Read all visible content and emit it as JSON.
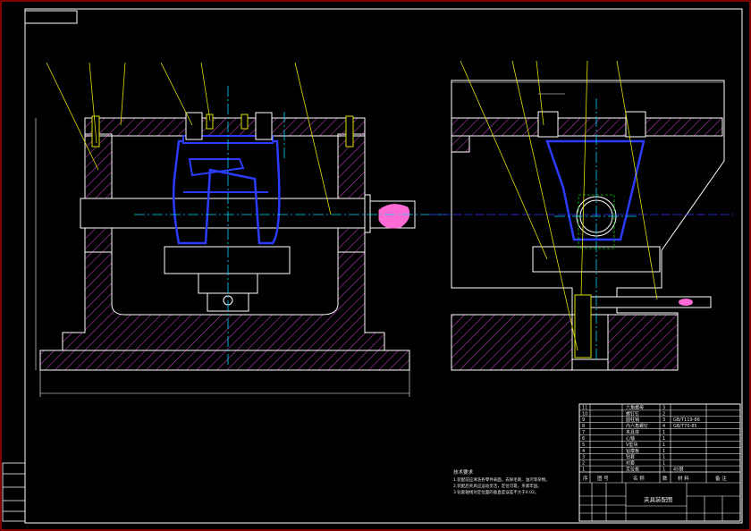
{
  "colors": {
    "background": "#000000",
    "border": "#ff0000",
    "outline": "#ffffff",
    "hatch": "#c040c0",
    "part": "#2b3cff",
    "centerline": "#00d8ff",
    "leader": "#e0e000",
    "fastener": "#e0e000",
    "workpiece": "#ff6ad5",
    "green": "#00c000"
  },
  "title_block": {
    "drawing_title": "夹具装配图",
    "columns": [
      "序",
      "图  号",
      "名  称",
      "数",
      "材  料",
      "备  注"
    ],
    "parts": [
      {
        "no": "11",
        "name": "六角螺母",
        "qty": "3",
        "material": ""
      },
      {
        "no": "10",
        "name": "螺钉钉",
        "qty": "2",
        "material": ""
      },
      {
        "no": "9",
        "name": "圆柱销",
        "qty": "3",
        "material": "GB/T119-86"
      },
      {
        "no": "8",
        "name": "内六角螺钉",
        "qty": "4",
        "material": "GB/T70-85"
      },
      {
        "no": "7",
        "name": "夹具体",
        "qty": "1",
        "material": ""
      },
      {
        "no": "6",
        "name": "心轴",
        "qty": "1",
        "material": ""
      },
      {
        "no": "5",
        "name": "V型块",
        "qty": "1",
        "material": ""
      },
      {
        "no": "4",
        "name": "钻模板",
        "qty": "1",
        "material": ""
      },
      {
        "no": "3",
        "name": "钻套",
        "qty": "1",
        "material": ""
      },
      {
        "no": "2",
        "name": "衬套",
        "qty": "1",
        "material": ""
      },
      {
        "no": "1",
        "name": "定位板",
        "qty": "1",
        "material": "45钢"
      }
    ]
  },
  "notes": {
    "heading": "技术要求",
    "lines": [
      "1.装配前应清洗各零件表面，去除毛刺、油污等杂物。",
      "2.装配后夹具应运动灵活，定位可靠，夹紧牢固。",
      "3.钻套轴线对定位面的垂直度误差不大于0.02。"
    ]
  }
}
